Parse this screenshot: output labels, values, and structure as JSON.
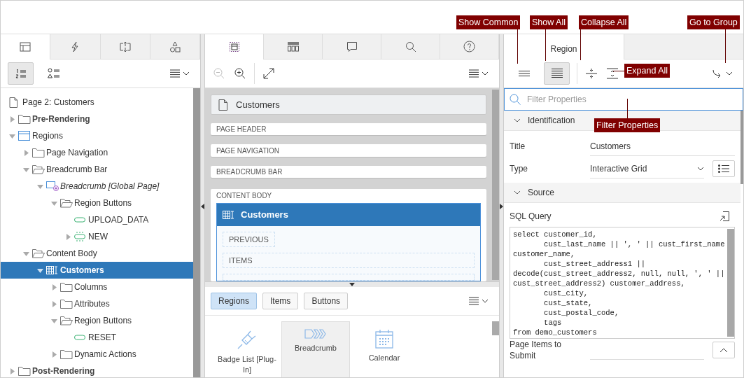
{
  "callouts": [
    {
      "label": "Show Common"
    },
    {
      "label": "Show All"
    },
    {
      "label": "Collapse All"
    },
    {
      "label": "Go to Group"
    },
    {
      "label": "Expand All"
    },
    {
      "label": "Filter Properties"
    }
  ],
  "left_panel": {
    "tabs": [
      {
        "kind": "rendering",
        "selected": true
      },
      {
        "kind": "dynamic-actions",
        "selected": false
      },
      {
        "kind": "processing",
        "selected": false
      },
      {
        "kind": "shared",
        "selected": false
      }
    ],
    "view_buttons": [
      {
        "kind": "order",
        "selected": true
      },
      {
        "kind": "type",
        "selected": false
      }
    ],
    "tree": {
      "page": "Page 2: Customers",
      "nodes": [
        {
          "label": "Pre-Rendering",
          "kind": "folder",
          "bold": true,
          "expanded": false,
          "selected": false
        },
        {
          "label": "Regions",
          "kind": "region",
          "expanded": true,
          "selected": false,
          "children": [
            {
              "label": "Page Navigation",
              "kind": "folder",
              "expanded": false,
              "selected": false
            },
            {
              "label": "Breadcrumb Bar",
              "kind": "folder",
              "expanded": true,
              "selected": false,
              "children": [
                {
                  "label": "Breadcrumb [Global Page]",
                  "kind": "breadcrumb",
                  "italic": true,
                  "expanded": true,
                  "selected": false,
                  "children": [
                    {
                      "label": "Region Buttons",
                      "kind": "folder",
                      "expanded": true,
                      "selected": false,
                      "children": [
                        {
                          "label": "UPLOAD_DATA",
                          "kind": "button",
                          "selected": false
                        },
                        {
                          "label": "NEW",
                          "kind": "conditional-button",
                          "expanded": false,
                          "selected": false
                        }
                      ]
                    }
                  ]
                }
              ]
            },
            {
              "label": "Content Body",
              "kind": "folder",
              "expanded": true,
              "selected": false,
              "children": [
                {
                  "label": "Customers",
                  "kind": "grid",
                  "expanded": true,
                  "selected": true,
                  "children": [
                    {
                      "label": "Columns",
                      "kind": "folder",
                      "expanded": false,
                      "selected": false
                    },
                    {
                      "label": "Attributes",
                      "kind": "folder",
                      "expanded": false,
                      "selected": false
                    },
                    {
                      "label": "Region Buttons",
                      "kind": "folder",
                      "expanded": true,
                      "selected": false,
                      "children": [
                        {
                          "label": "RESET",
                          "kind": "button",
                          "selected": false
                        }
                      ]
                    },
                    {
                      "label": "Dynamic Actions",
                      "kind": "folder",
                      "expanded": false,
                      "selected": false
                    }
                  ]
                }
              ]
            }
          ]
        },
        {
          "label": "Post-Rendering",
          "kind": "folder",
          "bold": true,
          "expanded": false,
          "selected": false
        }
      ]
    }
  },
  "layout_panel": {
    "tabs": [
      {
        "kind": "layout",
        "selected": true
      },
      {
        "kind": "components",
        "selected": false
      },
      {
        "kind": "messages",
        "selected": false
      },
      {
        "kind": "search",
        "selected": false
      },
      {
        "kind": "help",
        "selected": false
      }
    ],
    "page_title": "Customers",
    "positions": [
      "PAGE HEADER",
      "PAGE NAVIGATION",
      "BREADCRUMB BAR"
    ],
    "content_body": {
      "label": "CONTENT BODY",
      "region": {
        "title": "Customers",
        "slots": [
          "PREVIOUS",
          "ITEMS"
        ]
      }
    },
    "gallery": {
      "tabs": [
        {
          "label": "Regions",
          "selected": true
        },
        {
          "label": "Items",
          "selected": false
        },
        {
          "label": "Buttons",
          "selected": false
        }
      ],
      "items": [
        {
          "label": "Badge List [Plug-In]",
          "kind": "plugin",
          "selected": false
        },
        {
          "label": "Breadcrumb",
          "kind": "breadcrumb",
          "selected": true
        },
        {
          "label": "Calendar",
          "kind": "calendar",
          "selected": false
        }
      ]
    }
  },
  "property_editor": {
    "tabs": [
      {
        "label": "Region",
        "selected": true
      }
    ],
    "display_modes": [
      {
        "kind": "common",
        "selected": false
      },
      {
        "kind": "all",
        "selected": true
      }
    ],
    "filter": {
      "placeholder": "Filter Properties"
    },
    "groups": [
      {
        "title": "Identification",
        "expanded": true,
        "properties": [
          {
            "label": "Title",
            "kind": "text",
            "value": "Customers"
          },
          {
            "label": "Type",
            "kind": "select",
            "value": "Interactive Grid"
          }
        ]
      },
      {
        "title": "Source",
        "expanded": true,
        "properties": [
          {
            "label": "SQL Query",
            "kind": "code",
            "value": "select customer_id,\n       cust_last_name || ', ' || cust_first_name\ncustomer_name,\n       cust_street_address1 ||\ndecode(cust_street_address2, null, null, ', ' ||\ncust_street_address2) customer_address,\n       cust_city,\n       cust_state,\n       cust_postal_code,\n       tags\nfrom demo_customers"
          },
          {
            "label": "Page Items to Submit",
            "kind": "picker"
          }
        ]
      }
    ]
  }
}
